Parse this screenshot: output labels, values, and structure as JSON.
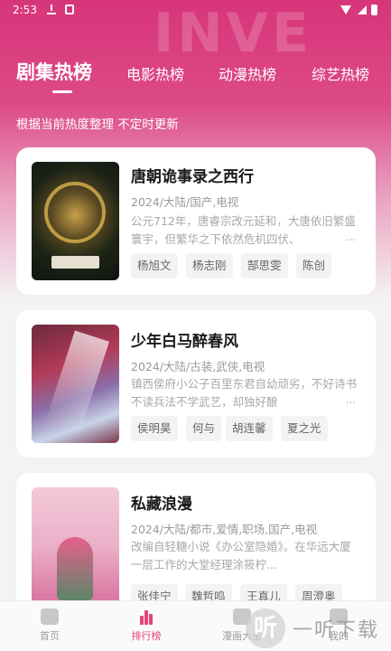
{
  "status_bar": {
    "time": "2:53"
  },
  "hero": {
    "decoration": "INVE"
  },
  "tabs": [
    {
      "label": "剧集热榜"
    },
    {
      "label": "电影热榜"
    },
    {
      "label": "动漫热榜"
    },
    {
      "label": "综艺热榜"
    }
  ],
  "subtitle": "根据当前热度整理 不定时更新",
  "items": [
    {
      "title": "唐朝诡事录之西行",
      "meta": "2024/大陆/国产,电视",
      "description": "公元712年，唐睿宗改元延和，大唐依旧繁盛寰宇，但繁华之下依然危机四伏、",
      "more": "...",
      "cast": [
        "杨旭文",
        "杨志刚",
        "郜思雯",
        "陈创"
      ]
    },
    {
      "title": "少年白马醉春风",
      "meta": "2024/大陆/古装,武侠,电视",
      "description": "镇西侯府小公子百里东君自幼顽劣，不好诗书不读兵法不学武艺，却独好酿",
      "more": "...",
      "cast": [
        "侯明昊",
        "何与",
        "胡连馨",
        "夏之光"
      ]
    },
    {
      "title": "私藏浪漫",
      "meta": "2024/大陆/都市,爱情,职场,国产,电视",
      "description": "改编自轻糖小说《办公室隐婚》。在华远大厦一层工作的大堂经理涂筱柠...",
      "more": "",
      "cast": [
        "张佳宁",
        "魏哲鸣",
        "王真儿",
        "周澄奥"
      ]
    }
  ],
  "bottom_nav": [
    {
      "label": "首页"
    },
    {
      "label": "排行榜"
    },
    {
      "label": "漫画大全"
    },
    {
      "label": "我的"
    }
  ],
  "watermark": {
    "logo": "听",
    "text": "一听下载"
  },
  "colors": {
    "accent": "#e0457f",
    "hero": "#d7357a"
  }
}
